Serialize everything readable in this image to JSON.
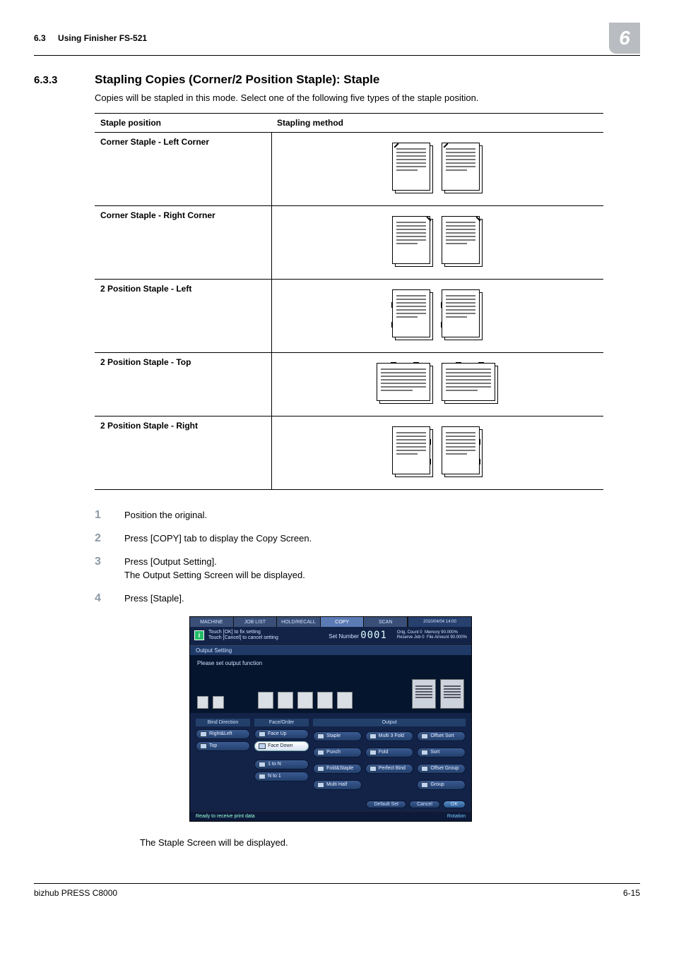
{
  "header": {
    "section_number": "6.3",
    "section_title": "Using Finisher FS-521",
    "chapter_badge": "6"
  },
  "section": {
    "number": "6.3.3",
    "title": "Stapling Copies (Corner/2 Position Staple): Staple",
    "intro": "Copies will be stapled in this mode. Select one of the following five types of the staple position."
  },
  "table": {
    "col1": "Staple position",
    "col2": "Stapling method",
    "rows": [
      {
        "label": "Corner Staple - Left Corner",
        "kind": "corner-left"
      },
      {
        "label": "Corner Staple - Right Corner",
        "kind": "corner-right"
      },
      {
        "label": "2 Position Staple - Left",
        "kind": "two-left"
      },
      {
        "label": "2 Position Staple - Top",
        "kind": "two-top"
      },
      {
        "label": "2 Position Staple - Right",
        "kind": "two-right"
      }
    ]
  },
  "steps": [
    {
      "n": "1",
      "lines": [
        "Position the original."
      ]
    },
    {
      "n": "2",
      "lines": [
        "Press [COPY] tab to display the Copy Screen."
      ]
    },
    {
      "n": "3",
      "lines": [
        "Press [Output Setting].",
        "The Output Setting Screen will be displayed."
      ]
    },
    {
      "n": "4",
      "lines": [
        "Press [Staple]."
      ]
    }
  ],
  "screen": {
    "tabs": [
      "MACHINE",
      "JOB LIST",
      "HOLD/RECALL",
      "COPY",
      "SCAN"
    ],
    "date": "2010/04/04 14:00",
    "info_line1": "Touch [OK] to fix setting",
    "info_line2": "Touch [Cancel] to cancel setting",
    "set_number_label": "Set Number",
    "set_number_value": "0001",
    "counters": {
      "orig_count_label": "Orig. Count",
      "orig_count_value": "0",
      "reserve_job_label": "Reserve Job",
      "reserve_job_value": "0",
      "memory_label": "Memory",
      "memory_value": "90.000%",
      "file_amount_label": "File Amount",
      "file_amount_value": "90.000%"
    },
    "sub_header": "Output Setting",
    "func_msg": "Please set output function",
    "groups": {
      "bind_direction": {
        "title": "Bind Direction",
        "items": [
          "Right&Left",
          "Top"
        ]
      },
      "face_order": {
        "title": "Face/Order",
        "items": [
          "Face Up",
          "Face Down",
          "1 to N",
          "N to 1"
        ],
        "selected": 1
      },
      "output": {
        "title": "Output",
        "items": [
          "Staple",
          "Multi 3 Fold",
          "Offset Sort",
          "Punch",
          "Fold",
          "Sort",
          "Fold&Staple",
          "Perfect Bind",
          "Offset Group",
          "Multi Half",
          "",
          "Group"
        ]
      }
    },
    "footer_buttons": [
      "Default Set",
      "Cancel",
      "OK"
    ],
    "ready_text": "Ready to receive print data",
    "rotation": "Rotation"
  },
  "after_screen": "The Staple Screen will be displayed.",
  "footer": {
    "left": "bizhub PRESS C8000",
    "right": "6-15"
  }
}
